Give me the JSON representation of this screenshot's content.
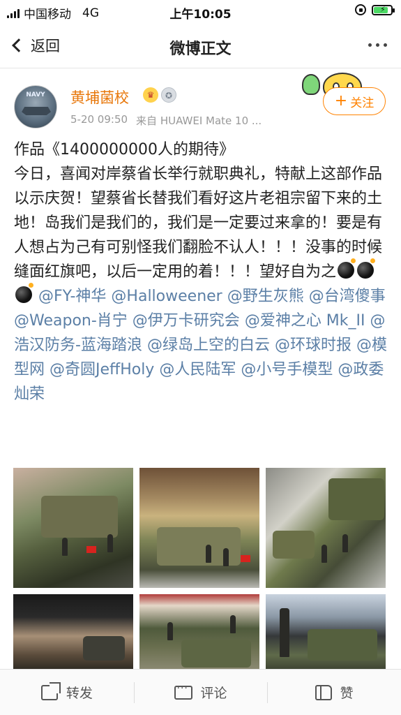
{
  "status_bar": {
    "carrier": "中国移动",
    "network": "4G",
    "time": "上午10:05"
  },
  "nav": {
    "back_label": "返回",
    "title": "微博正文"
  },
  "post": {
    "author": "黄埔菌校",
    "avatar_text": "NAVY",
    "time": "5-20 09:50",
    "source": "来自 HUAWEI Mate 10 ...",
    "follow_label": "关注",
    "text_lines": [
      "作品《1400000000人的期待》",
      "今日，喜闻对岸蔡省长举行就职典礼，特献上这部作品以示庆贺！望蔡省长替我们看好这片老祖宗留下来的土地！岛我们是我们的，我们是一定要过来拿的！要是有人想占为己有可别怪我们翻脸不认人！！！没事的时候缝面红旗吧，以后一定用的着！！！望好自为之"
    ],
    "mentions": [
      "@FY-神华",
      "@Halloweener",
      "@野生灰熊",
      "@台湾傻事",
      "@Weapon-肖宁",
      "@伊万卡研究会",
      "@爱神之心 Mk_II",
      "@浩汉防务-蓝海踏浪",
      "@绿岛上空的白云",
      "@环球时报",
      "@模型网",
      "@奇圆JeffHoly",
      "@人民陆军",
      "@小号手模型",
      "@政委灿荣"
    ],
    "image_count": 6
  },
  "actions": {
    "repost": "转发",
    "comment": "评论",
    "like": "赞"
  },
  "colors": {
    "mention": "#5b7fa6",
    "username": "#e8780c",
    "follow": "#ff8200",
    "battery": "#4cd964"
  }
}
